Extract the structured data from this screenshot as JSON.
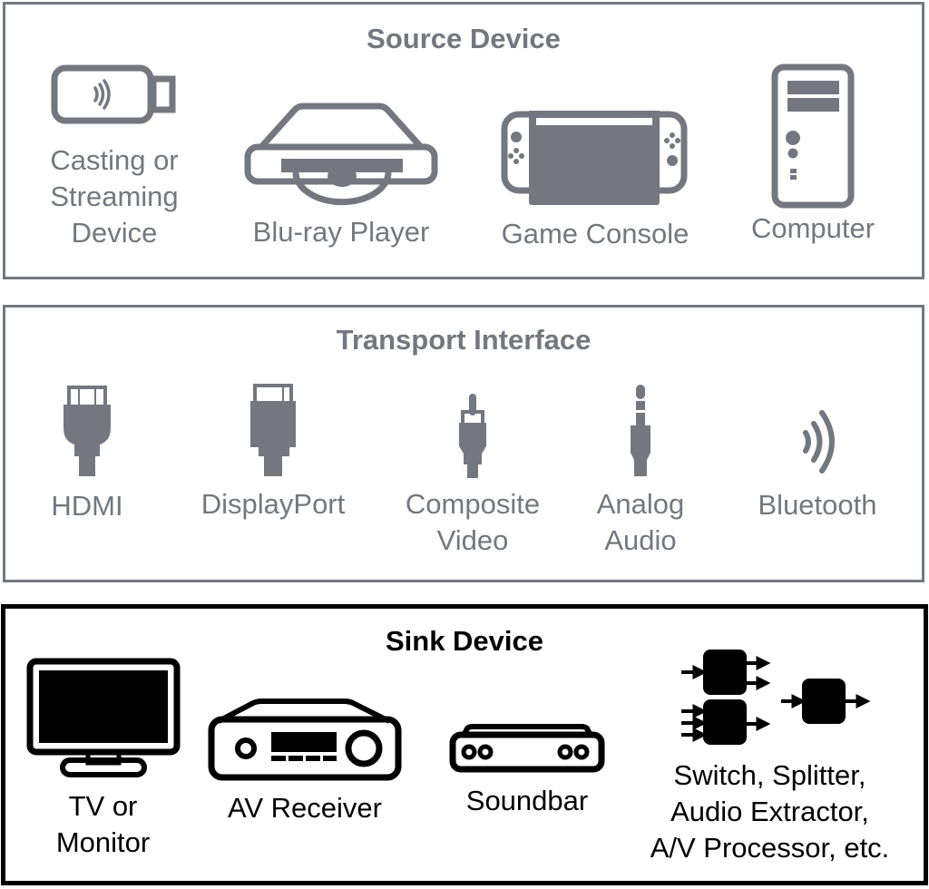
{
  "panels": {
    "source": {
      "title": "Source Device",
      "color": "#74777f",
      "items": [
        {
          "label_lines": [
            "Casting or",
            "Streaming",
            "Device"
          ],
          "icon": "streaming-stick-icon"
        },
        {
          "label_lines": [
            "Blu-ray Player"
          ],
          "icon": "disc-player-icon"
        },
        {
          "label_lines": [
            "Game Console"
          ],
          "icon": "game-console-icon"
        },
        {
          "label_lines": [
            "Computer"
          ],
          "icon": "computer-tower-icon"
        }
      ]
    },
    "transport": {
      "title": "Transport Interface",
      "color": "#74777f",
      "items": [
        {
          "label_lines": [
            "HDMI"
          ],
          "icon": "hdmi-plug-icon"
        },
        {
          "label_lines": [
            "DisplayPort"
          ],
          "icon": "displayport-plug-icon"
        },
        {
          "label_lines": [
            "Composite",
            "Video"
          ],
          "icon": "rca-plug-icon"
        },
        {
          "label_lines": [
            "Analog",
            "Audio"
          ],
          "icon": "audio-jack-icon"
        },
        {
          "label_lines": [
            "Bluetooth"
          ],
          "icon": "wireless-signal-icon"
        }
      ]
    },
    "sink": {
      "title": "Sink Device",
      "color": "#000000",
      "items": [
        {
          "label_lines": [
            "TV or",
            "Monitor"
          ],
          "icon": "tv-monitor-icon"
        },
        {
          "label_lines": [
            "AV Receiver"
          ],
          "icon": "av-receiver-icon"
        },
        {
          "label_lines": [
            "Soundbar"
          ],
          "icon": "soundbar-icon"
        },
        {
          "label_lines": [
            "Switch, Splitter,",
            "Audio Extractor,",
            "A/V Processor, etc."
          ],
          "icon": "signal-processor-icon"
        }
      ]
    }
  }
}
